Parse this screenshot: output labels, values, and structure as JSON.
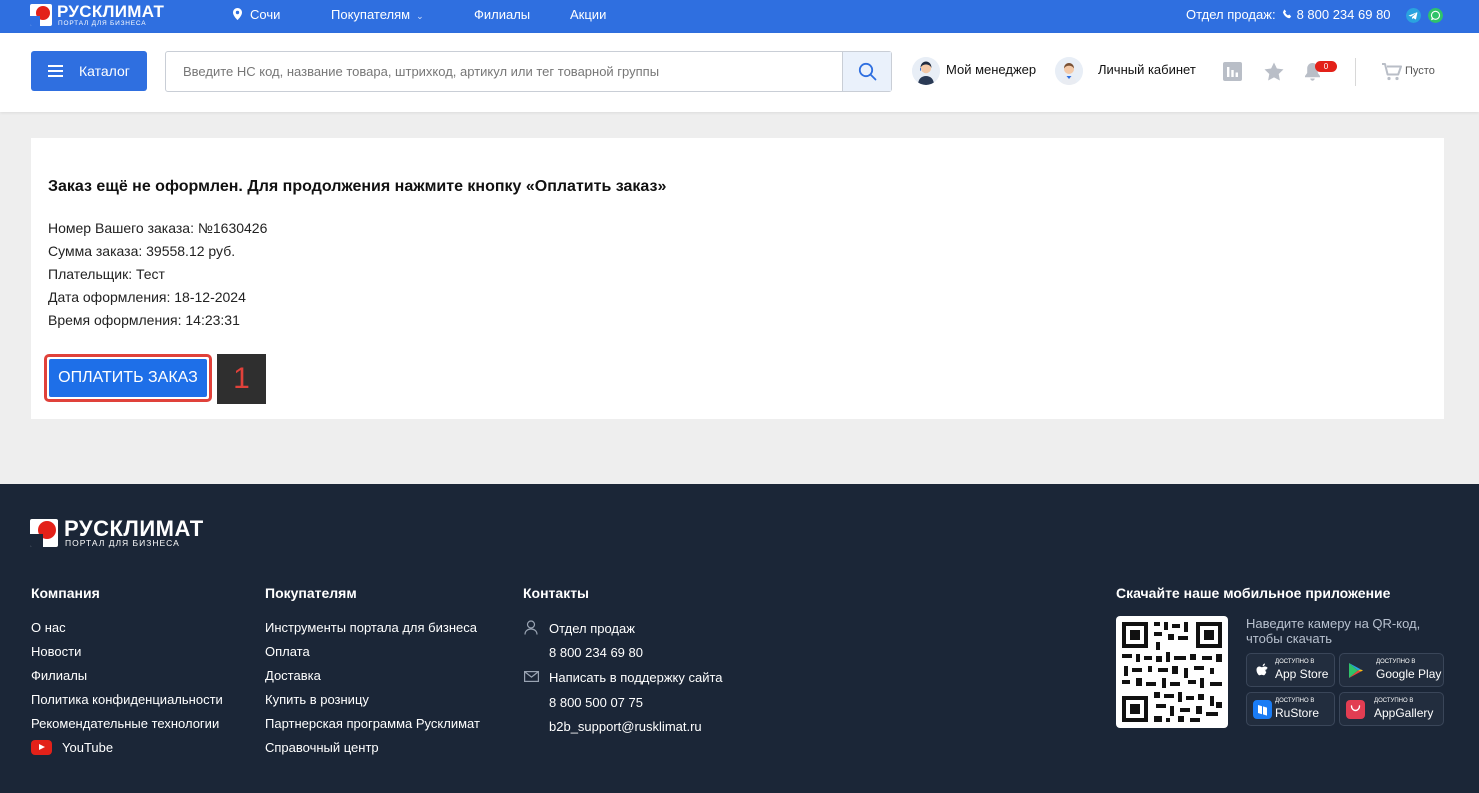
{
  "topbar": {
    "logo_text": "РУСКЛИМАТ",
    "logo_sub": "ПОРТАЛ ДЛЯ БИЗНЕСА",
    "city": "Сочи",
    "nav": [
      "Покупателям",
      "Филиалы",
      "Акции"
    ],
    "sales_label": "Отдел продаж:",
    "sales_phone": "8 800 234 69 80"
  },
  "header": {
    "catalog_label": "Каталог",
    "search_placeholder": "Введите НС код, название товара, штрихкод, артикул или тег товарной группы",
    "manager_label": "Мой менеджер",
    "cabinet_label": "Личный кабинет",
    "notifications_count": "0",
    "cart_label": "Пусто"
  },
  "order": {
    "title": "Заказ ещё не оформлен. Для продолжения нажмите кнопку «Оплатить заказ»",
    "lines": [
      "Номер Вашего заказа: №1630426",
      "Сумма заказа: 39558.12 руб.",
      "Плательщик: Тест",
      "Дата оформления: 18-12-2024",
      "Время оформления: 14:23:31"
    ],
    "pay_button": "ОПЛАТИТЬ ЗАКАЗ",
    "step_badge": "1"
  },
  "footer": {
    "logo_text": "РУСКЛИМАТ",
    "logo_sub": "ПОРТАЛ ДЛЯ БИЗНЕСА",
    "company": {
      "title": "Компания",
      "links": [
        "О нас",
        "Новости",
        "Филиалы",
        "Политика конфиденциальности",
        "Рекомендательные технологии",
        "YouTube"
      ]
    },
    "buyers": {
      "title": "Покупателям",
      "links": [
        "Инструменты портала для бизнеса",
        "Оплата",
        "Доставка",
        "Купить в розницу",
        "Партнерская программа Русклимат",
        "Справочный центр"
      ]
    },
    "contacts": {
      "title": "Контакты",
      "sales_label": "Отдел продаж",
      "sales_phone": "8 800 234 69 80",
      "support_label": "Написать в поддержку сайта",
      "support_phone": "8 800 500 07 75",
      "support_email": "b2b_support@rusklimat.ru"
    },
    "app": {
      "title": "Скачайте наше мобильное приложение",
      "hint": "Наведите камеру на QR-код, чтобы скачать",
      "available": "ДОСТУПНО В",
      "stores": [
        "App Store",
        "Google Play",
        "RuStore",
        "AppGallery"
      ]
    }
  },
  "colors": {
    "brand_blue": "#2f6fe0",
    "brand_red": "#e32119",
    "footer_bg": "#1b2637"
  }
}
